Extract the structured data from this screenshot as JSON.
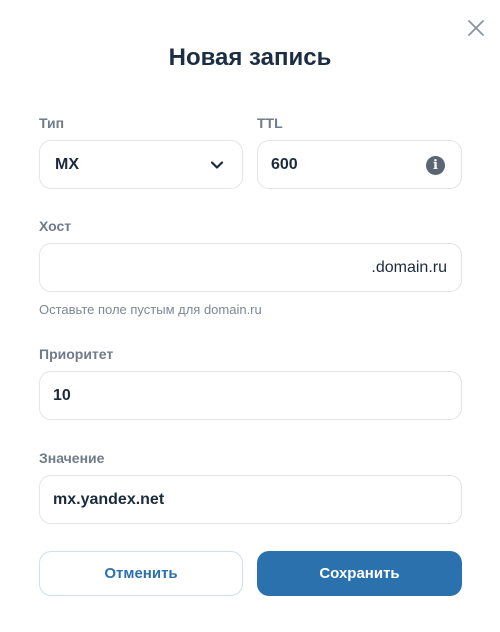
{
  "dialog": {
    "title": "Новая запись",
    "close_icon": "close-icon"
  },
  "fields": {
    "type": {
      "label": "Тип",
      "value": "MX",
      "icon": "chevron-down-icon"
    },
    "ttl": {
      "label": "TTL",
      "value": "600",
      "icon": "info-icon",
      "icon_glyph": "i"
    },
    "host": {
      "label": "Хост",
      "value": "",
      "suffix": ".domain.ru",
      "hint": "Оставьте поле пустым для domain.ru"
    },
    "priority": {
      "label": "Приоритет",
      "value": "10"
    },
    "value": {
      "label": "Значение",
      "value": "mx.yandex.net"
    }
  },
  "buttons": {
    "cancel": "Отменить",
    "save": "Сохранить"
  },
  "colors": {
    "primary": "#2a71ad",
    "title": "#1c2e42",
    "label": "#6f7b88",
    "border": "#e2e6ea"
  }
}
